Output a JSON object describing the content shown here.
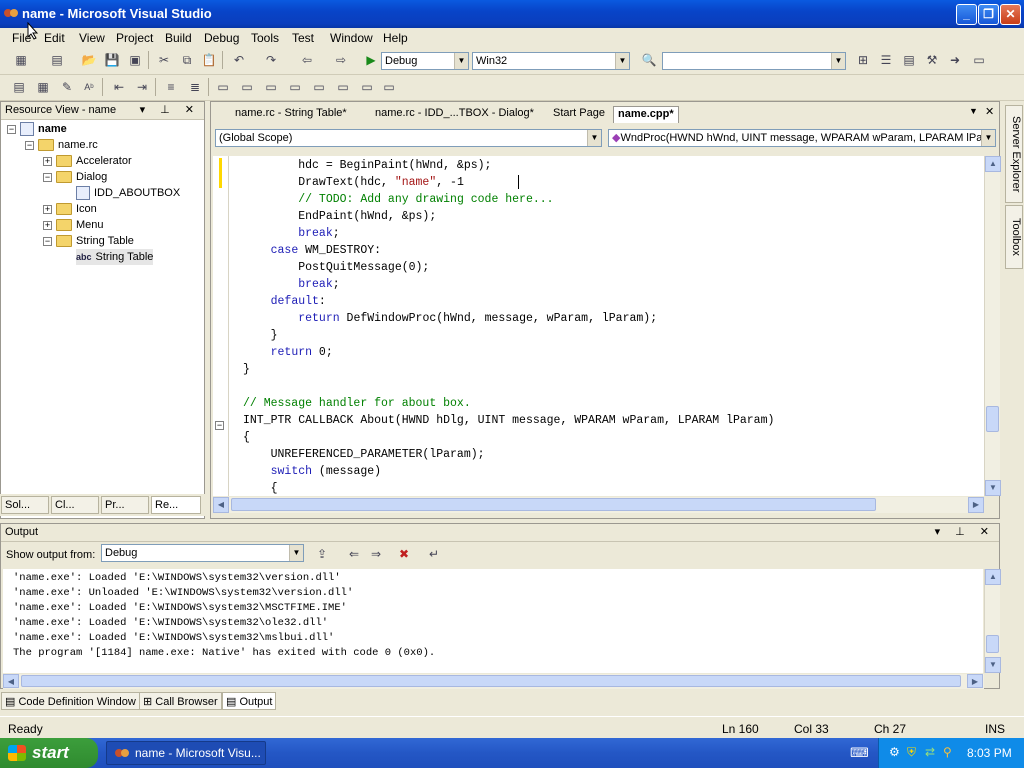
{
  "window": {
    "title": "name - Microsoft Visual Studio"
  },
  "menu": [
    "File",
    "Edit",
    "View",
    "Project",
    "Build",
    "Debug",
    "Tools",
    "Test",
    "Window",
    "Help"
  ],
  "toolbar": {
    "config": "Debug",
    "platform": "Win32",
    "find": ""
  },
  "resource_view": {
    "title": "Resource View - name",
    "tree": [
      {
        "label": "name",
        "level": 0,
        "type": "project",
        "bold": true
      },
      {
        "label": "name.rc",
        "level": 1,
        "type": "folder"
      },
      {
        "label": "Accelerator",
        "level": 2,
        "type": "folder"
      },
      {
        "label": "Dialog",
        "level": 2,
        "type": "folder"
      },
      {
        "label": "IDD_ABOUTBOX",
        "level": 3,
        "type": "file"
      },
      {
        "label": "Icon",
        "level": 2,
        "type": "folder"
      },
      {
        "label": "Menu",
        "level": 2,
        "type": "folder"
      },
      {
        "label": "String Table",
        "level": 2,
        "type": "folder"
      },
      {
        "label": "String Table",
        "level": 3,
        "type": "abc"
      }
    ],
    "tabs": [
      "Sol...",
      "Cl...",
      "Pr...",
      "Re..."
    ]
  },
  "editor": {
    "tabs": [
      "name.rc - String Table*",
      "name.rc - IDD_...TBOX - Dialog*",
      "Start Page",
      "name.cpp*"
    ],
    "active_tab": "name.cpp*",
    "scope": "(Global Scope)",
    "member": "WndProc(HWND hWnd, UINT message, WPARAM wParam, LPARAM lPara",
    "lines": [
      "        hdc = BeginPaint(hWnd, &ps);",
      "        DrawText(hdc, \"name\", -1",
      "        // TODO: Add any drawing code here...",
      "        EndPaint(hWnd, &ps);",
      "        break;",
      "    case WM_DESTROY:",
      "        PostQuitMessage(0);",
      "        break;",
      "    default:",
      "        return DefWindowProc(hWnd, message, wParam, lParam);",
      "    }",
      "    return 0;",
      "}",
      "",
      "// Message handler for about box.",
      "INT_PTR CALLBACK About(HWND hDlg, UINT message, WPARAM wParam, LPARAM lParam)",
      "{",
      "    UNREFERENCED_PARAMETER(lParam);",
      "    switch (message)",
      "    {"
    ]
  },
  "output": {
    "title": "Output",
    "show_from_label": "Show output from:",
    "source": "Debug",
    "lines": [
      "'name.exe': Loaded 'E:\\WINDOWS\\system32\\version.dll'",
      "'name.exe': Unloaded 'E:\\WINDOWS\\system32\\version.dll'",
      "'name.exe': Loaded 'E:\\WINDOWS\\system32\\MSCTFIME.IME'",
      "'name.exe': Loaded 'E:\\WINDOWS\\system32\\ole32.dll'",
      "'name.exe': Loaded 'E:\\WINDOWS\\system32\\mslbui.dll'",
      "The program '[1184] name.exe: Native' has exited with code 0 (0x0)."
    ],
    "tabs": [
      "Code Definition Window",
      "Call Browser",
      "Output"
    ]
  },
  "side_tabs": [
    "Server Explorer",
    "Toolbox"
  ],
  "status": {
    "ready": "Ready",
    "ln": "Ln 160",
    "col": "Col 33",
    "ch": "Ch 27",
    "mode": "INS"
  },
  "taskbar": {
    "start": "start",
    "item": "name - Microsoft Visu...",
    "clock": "8:03 PM"
  }
}
